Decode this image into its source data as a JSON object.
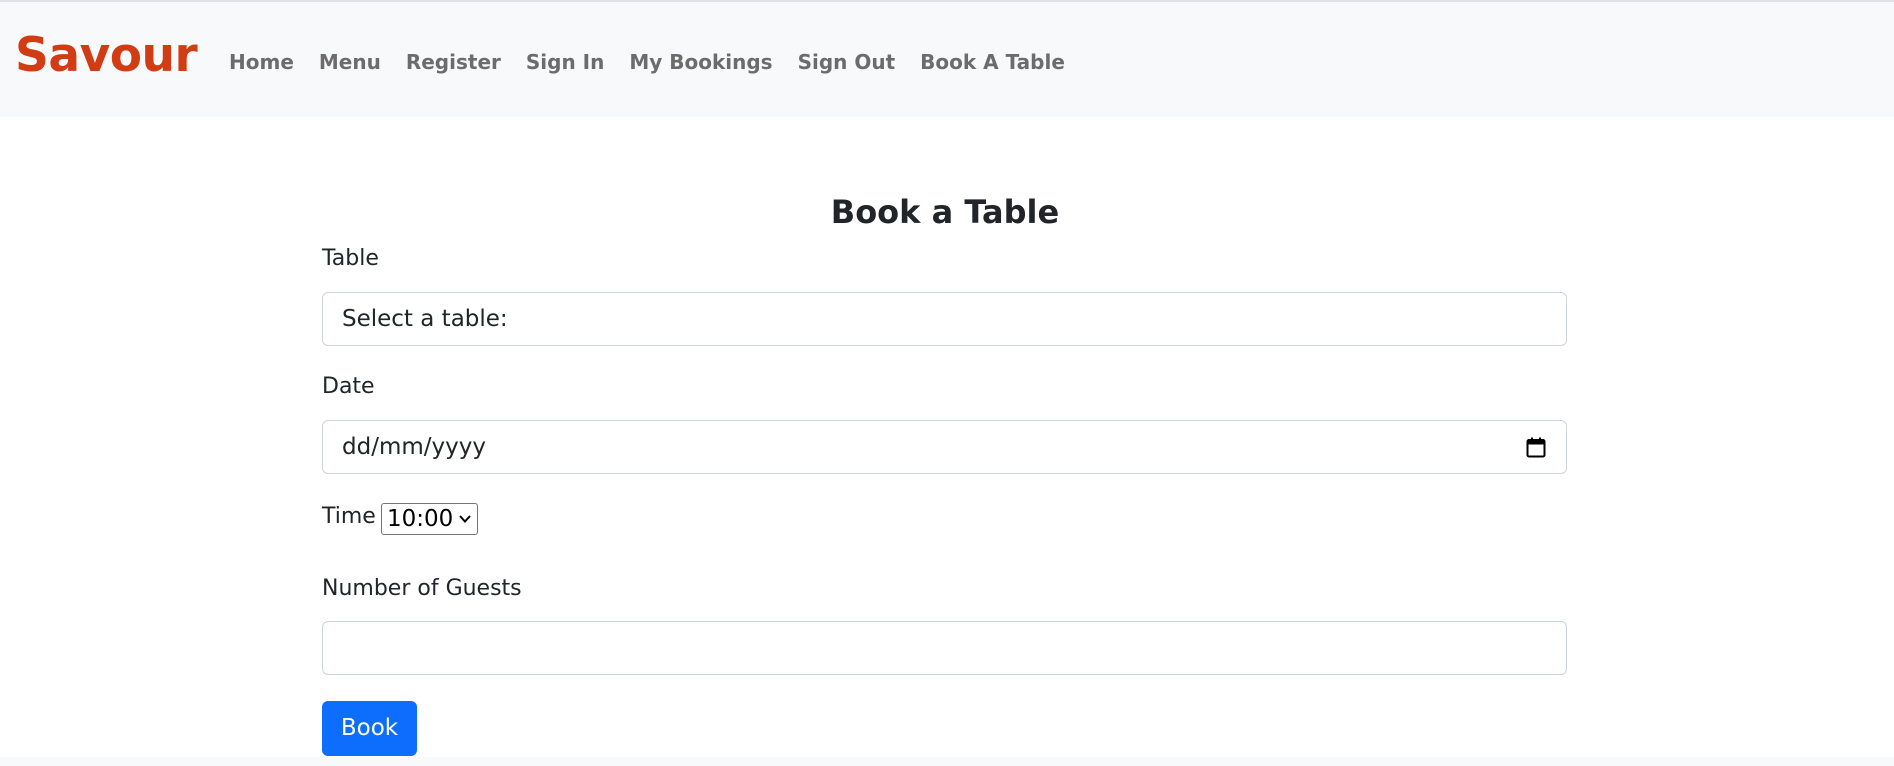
{
  "brand": {
    "name": "Savour",
    "color": "#d13c14"
  },
  "nav": {
    "links": [
      {
        "label": "Home"
      },
      {
        "label": "Menu"
      },
      {
        "label": "Register"
      },
      {
        "label": "Sign In"
      },
      {
        "label": "My Bookings"
      },
      {
        "label": "Sign Out"
      },
      {
        "label": "Book A Table"
      }
    ]
  },
  "page": {
    "title": "Book a Table"
  },
  "form": {
    "table": {
      "label": "Table",
      "value": "Select a table:"
    },
    "date": {
      "label": "Date",
      "placeholder": "dd/mm/yyyy",
      "icon": "calendar-icon"
    },
    "time": {
      "label": "Time",
      "value": "10:00"
    },
    "guests": {
      "label": "Number of Guests",
      "value": ""
    },
    "submit": {
      "label": "Book",
      "color": "#0d6efd"
    }
  }
}
